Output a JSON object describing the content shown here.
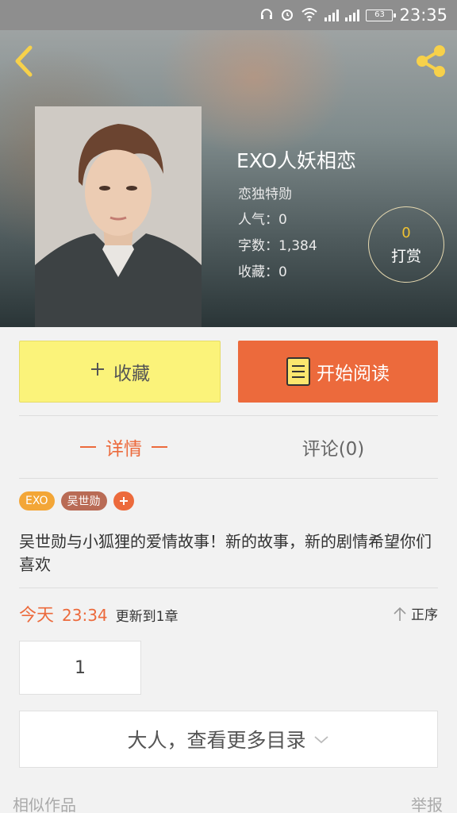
{
  "status_bar": {
    "time": "23:35",
    "battery": "63",
    "icons": [
      "headphones-icon",
      "alarm-icon",
      "wifi-icon",
      "signal-icon",
      "signal-icon",
      "battery-icon"
    ]
  },
  "header": {
    "back_icon": "chevron-left-icon",
    "share_icon": "share-icon"
  },
  "book": {
    "title": "EXO人妖相恋",
    "author": "恋独特勋",
    "popularity": "人气：0",
    "word_count": "字数：1,384",
    "favorites": "收藏：0",
    "reward_count": "0",
    "reward_label": "打赏"
  },
  "actions": {
    "collect_label": "收藏",
    "read_label": "开始阅读"
  },
  "tabs": {
    "detail": "详情",
    "comments": "评论(0)"
  },
  "tags": [
    "EXO",
    "吴世勋"
  ],
  "description": "吴世勋与小狐狸的爱情故事！新的故事，新的剧情希望你们喜欢",
  "update": {
    "day": "今天",
    "time": "23:34",
    "text": "更新到1章",
    "sort_label": "正序"
  },
  "chapters": [
    "1"
  ],
  "more_toc": "大人，查看更多目录",
  "footer": {
    "similar": "相似作品",
    "report": "举报"
  },
  "colors": {
    "accent": "#ec6a3c",
    "collect_bg": "#fbf37a",
    "tag_exo": "#f3a637",
    "tag_name": "#b96b55"
  }
}
